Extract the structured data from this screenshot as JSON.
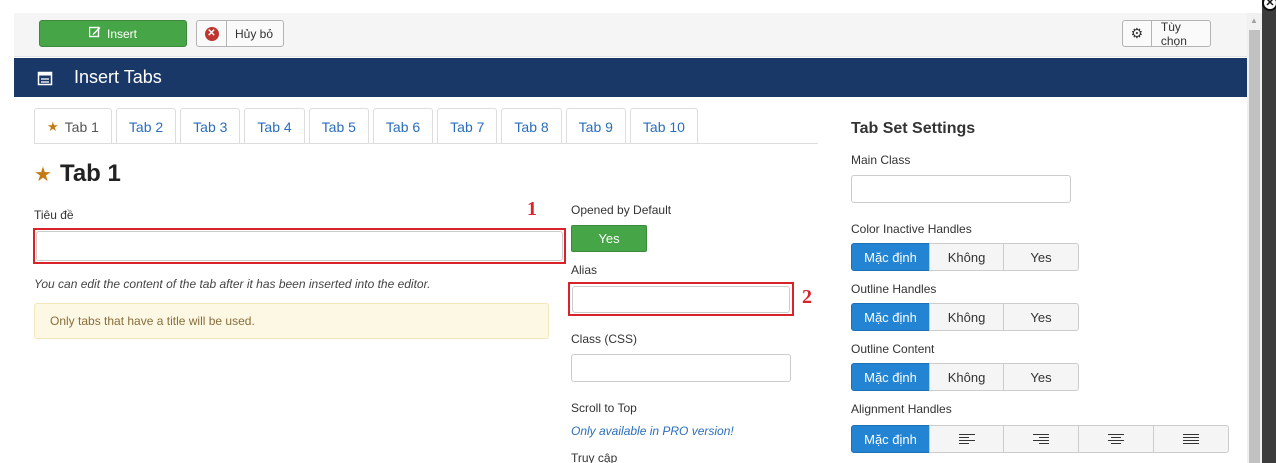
{
  "toolbar": {
    "insert_label": "Insert",
    "cancel_label": "Hủy bỏ",
    "options_label": "Tùy chọn"
  },
  "header": {
    "title": "Insert Tabs"
  },
  "tabs": [
    "Tab 1",
    "Tab 2",
    "Tab 3",
    "Tab 4",
    "Tab 5",
    "Tab 6",
    "Tab 7",
    "Tab 8",
    "Tab 9",
    "Tab 10"
  ],
  "active_tab": {
    "title": "Tab 1"
  },
  "form": {
    "title_label": "Tiêu đề",
    "title_value": "",
    "edit_note": "You can edit the content of the tab after it has been inserted into the editor.",
    "alert": "Only tabs that have a title will be used.",
    "opened_label": "Opened by Default",
    "opened_value": "Yes",
    "alias_label": "Alias",
    "alias_value": "",
    "class_label": "Class (CSS)",
    "class_value": "",
    "scroll_label": "Scroll to Top",
    "scroll_note": "Only available in PRO version!",
    "access_label": "Truy cập"
  },
  "annotations": {
    "mark1": "1",
    "mark2": "2"
  },
  "settings": {
    "title": "Tab Set Settings",
    "main_class_label": "Main Class",
    "main_class_value": "",
    "groups": [
      {
        "label": "Color Inactive Handles",
        "options": [
          "Mặc định",
          "Không",
          "Yes"
        ],
        "selected": "Mặc định"
      },
      {
        "label": "Outline Handles",
        "options": [
          "Mặc định",
          "Không",
          "Yes"
        ],
        "selected": "Mặc định"
      },
      {
        "label": "Outline Content",
        "options": [
          "Mặc định",
          "Không",
          "Yes"
        ],
        "selected": "Mặc định"
      }
    ],
    "alignment": {
      "label": "Alignment Handles",
      "default_label": "Mặc định",
      "icons": [
        "align-left-icon",
        "align-right-icon",
        "align-center-icon",
        "align-justify-icon"
      ]
    }
  },
  "colors": {
    "primary": "#1a3867",
    "success": "#46a546",
    "accent": "#2384d3",
    "annotation": "#d8232a",
    "star": "#c57b13"
  }
}
